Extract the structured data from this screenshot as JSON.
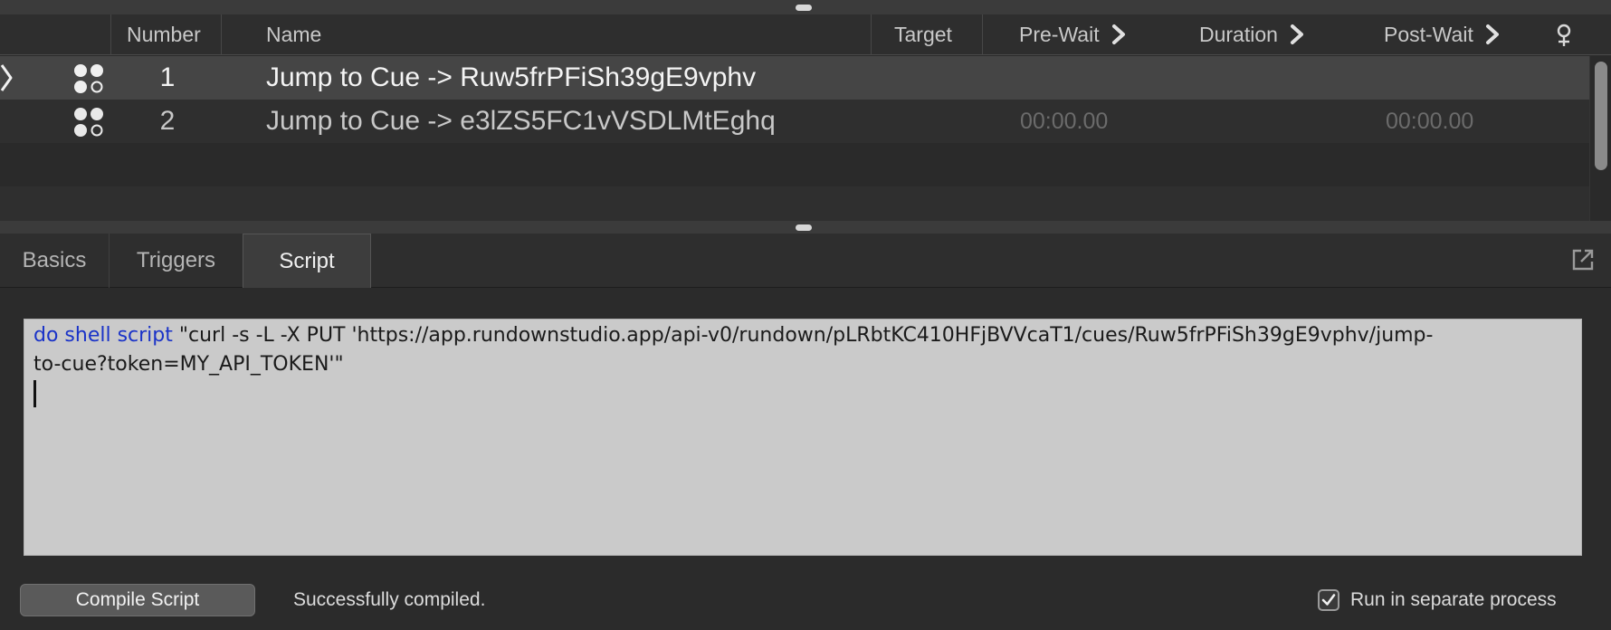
{
  "columns": {
    "number": "Number",
    "name": "Name",
    "target": "Target",
    "pre_wait": "Pre-Wait",
    "duration": "Duration",
    "post_wait": "Post-Wait",
    "hotkey_icon": "pin-icon"
  },
  "cues": [
    {
      "number": "1",
      "name": "Jump to Cue -> Ruw5frPFiSh39gE9vphv",
      "pre_wait": "",
      "post_wait": "",
      "selected": true
    },
    {
      "number": "2",
      "name": "Jump to Cue -> e3lZS5FC1vVSDLMtEghq",
      "pre_wait": "00:00.00",
      "post_wait": "00:00.00",
      "selected": false
    }
  ],
  "tabs": [
    "Basics",
    "Triggers",
    "Script"
  ],
  "active_tab": "Script",
  "script": {
    "keyword": "do shell script",
    "line1_rest": " \"curl -s -L -X PUT 'https://app.rundownstudio.app/api-v0/rundown/pLRbtKC410HFjBVVcaT1/cues/Ruw5frPFiSh39gE9vphv/jump-",
    "line2": "to-cue?token=MY_API_TOKEN'\""
  },
  "footer": {
    "compile_button": "Compile Script",
    "status": "Successfully compiled.",
    "separate_process_label": "Run in separate process",
    "separate_process_checked": true
  },
  "colors": {
    "keyword": "#1a33c8",
    "selected_row": "#454545",
    "editor_bg": "#cacaca"
  }
}
